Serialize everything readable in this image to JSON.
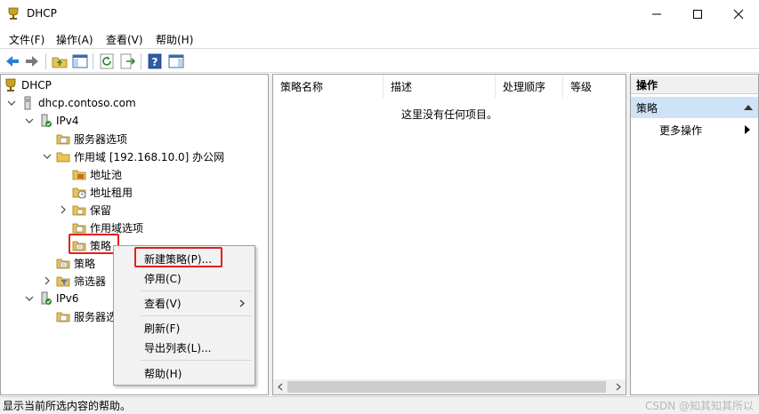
{
  "window": {
    "title": "DHCP"
  },
  "menubar": [
    "文件(F)",
    "操作(A)",
    "查看(V)",
    "帮助(H)"
  ],
  "tree": {
    "root": "DHCP",
    "server": "dhcp.contoso.com",
    "ipv4": "IPv4",
    "ipv4_server_options": "服务器选项",
    "scope": "作用域 [192.168.10.0] 办公网",
    "address_pool": "地址池",
    "address_leases": "地址租用",
    "reservations": "保留",
    "scope_options": "作用域选项",
    "scope_policies": "策略",
    "policies": "策略",
    "filters": "筛选器",
    "ipv6": "IPv6",
    "ipv6_server_options": "服务器选"
  },
  "list": {
    "columns": [
      "策略名称",
      "描述",
      "处理顺序",
      "等级"
    ],
    "empty_text": "这里没有任何项目。"
  },
  "actions": {
    "header": "操作",
    "section": "策略",
    "more": "更多操作"
  },
  "context_menu": {
    "new_policy": "新建策略(P)...",
    "disable": "停用(C)",
    "view": "查看(V)",
    "refresh": "刷新(F)",
    "export": "导出列表(L)...",
    "help": "帮助(H)"
  },
  "status": "显示当前所选内容的帮助。",
  "watermark": "CSDN @知其知其所以",
  "colors": {
    "highlight": "#e02020",
    "selection": "#cfe3f6",
    "folder": "#e8c35a"
  }
}
